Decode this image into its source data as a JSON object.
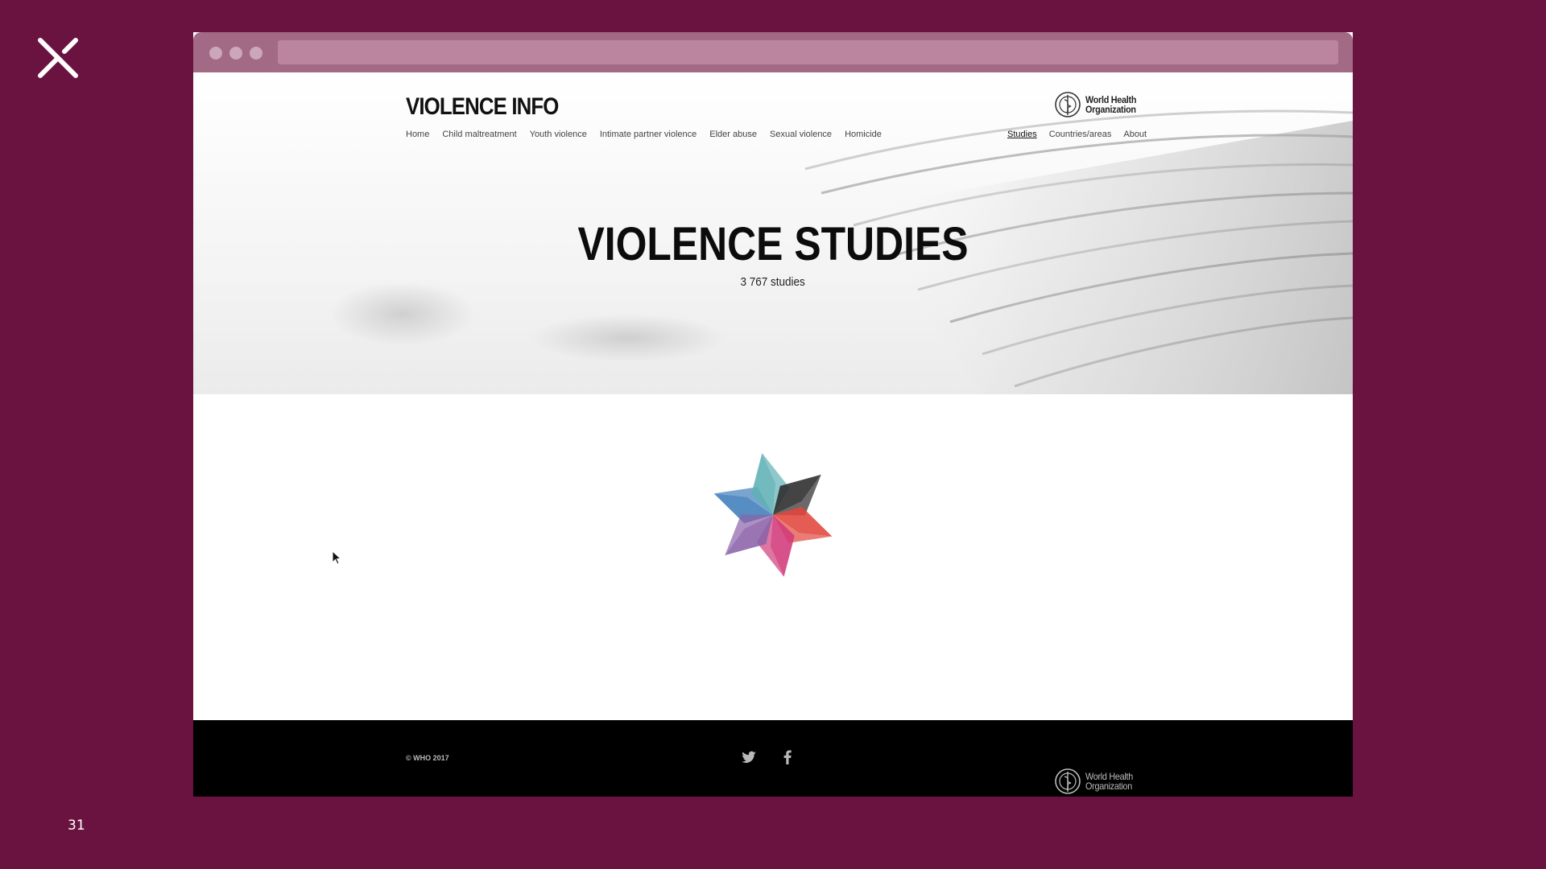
{
  "slide": {
    "number": "31"
  },
  "site": {
    "title": "VIOLENCE INFO",
    "who_logo_text_line1": "World Health",
    "who_logo_text_line2": "Organization"
  },
  "nav": {
    "left": [
      "Home",
      "Child maltreatment",
      "Youth violence",
      "Intimate partner violence",
      "Elder abuse",
      "Sexual violence",
      "Homicide"
    ],
    "right": [
      "Studies",
      "Countries/areas",
      "About"
    ],
    "active": "Studies"
  },
  "hero": {
    "title": "VIOLENCE STUDIES",
    "count": "3 767 studies"
  },
  "footer": {
    "copyright": "© WHO 2017",
    "social": [
      "twitter-icon",
      "facebook-icon"
    ]
  },
  "colors": {
    "slide_background": "#6b1340",
    "footer_background": "#000000",
    "loader_petals": [
      "#3f7dba",
      "#5fb0b5",
      "#2a2a2a",
      "#e0463c",
      "#d23a7a",
      "#8b63a8"
    ]
  }
}
